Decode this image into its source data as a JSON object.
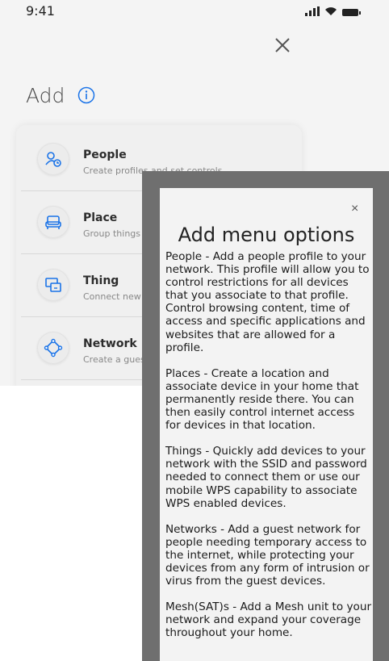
{
  "status_bar": {
    "time": "9:41"
  },
  "header": {
    "title": "Add"
  },
  "menu": {
    "items": [
      {
        "title": "People",
        "subtitle": "Create profiles and set controls"
      },
      {
        "title": "Place",
        "subtitle": "Group things"
      },
      {
        "title": "Thing",
        "subtitle": "Connect new"
      },
      {
        "title": "Network",
        "subtitle": "Create a gues"
      }
    ]
  },
  "help": {
    "close": "×",
    "title": "Add menu options",
    "paragraphs": [
      "People - Add a people profile to your network. This profile will allow you to control restrictions for all devices that you associate to that profile. Control browsing content, time of access and specific applications and websites that are allowed for a profile.",
      "Places -  Create a location and associate device in your home that permanently reside there. You can then easily control internet access for devices in that location.",
      "Things - Quickly add devices to your network with the SSID and password needed to connect them or use our mobile WPS capability to associate WPS enabled devices.",
      "Networks - Add a guest network for people needing temporary access to the internet, while protecting your devices from any form of intrusion or virus from the guest devices.",
      "Mesh(SAT)s - Add a Mesh unit to your network and expand your coverage throughout your home."
    ]
  },
  "colors": {
    "accent": "#1a73e8",
    "overlay": "#6f6f6f"
  }
}
